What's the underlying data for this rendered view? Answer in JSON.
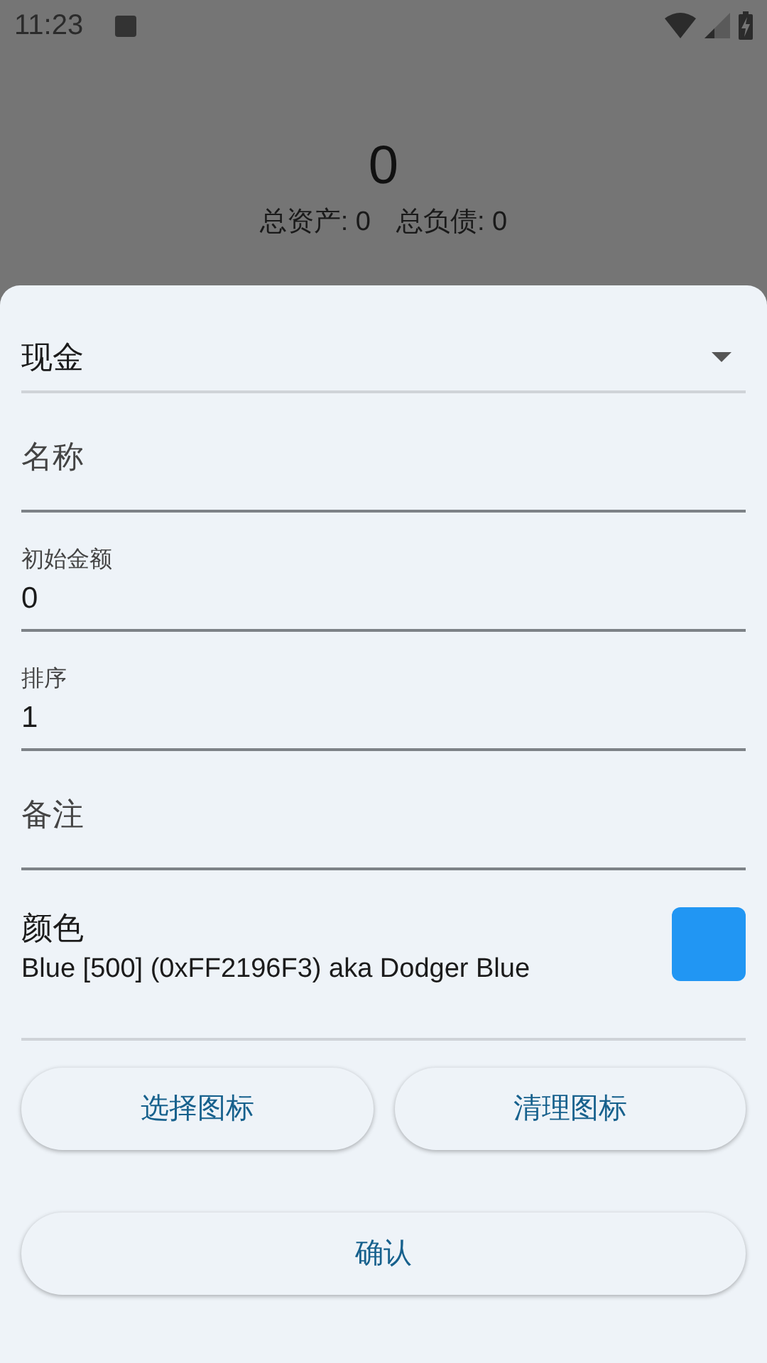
{
  "status_bar": {
    "time": "11:23"
  },
  "summary": {
    "total": "0",
    "assets_label": "总资产: 0",
    "liabilities_label": "总负债: 0"
  },
  "sheet": {
    "fields": [
      {
        "kind": "dropdown",
        "value": "现金"
      },
      {
        "kind": "text",
        "placeholder": "名称"
      },
      {
        "kind": "text",
        "label": "初始金额",
        "value": "0"
      },
      {
        "kind": "text",
        "label": "排序",
        "value": "1"
      },
      {
        "kind": "text",
        "placeholder": "备注"
      }
    ],
    "color_picker": {
      "label": "颜色",
      "description": "Blue [500] (0xFF2196F3) aka Dodger Blue",
      "color": "#2196f3"
    },
    "buttons": [
      "选择图标",
      "清理图标"
    ],
    "confirm": "确认"
  }
}
